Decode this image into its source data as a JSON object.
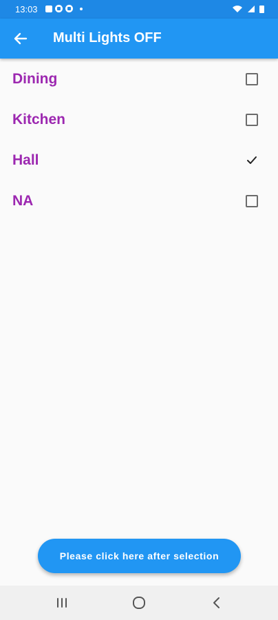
{
  "status_bar": {
    "time": "13:03",
    "left_icons": [
      "image-icon",
      "grid-app-icon",
      "grid-app-icon",
      "dot-icon"
    ],
    "right_icons": [
      "wifi-icon",
      "signal-icon",
      "battery-icon"
    ]
  },
  "app_bar": {
    "back_icon": "arrow-left-icon",
    "title": "Multi Lights OFF"
  },
  "lights": [
    {
      "label": "Dining",
      "checked": false
    },
    {
      "label": "Kitchen",
      "checked": false
    },
    {
      "label": "Hall",
      "checked": true
    },
    {
      "label": "NA",
      "checked": false
    }
  ],
  "action_button": {
    "label": "Please click here after selection"
  },
  "nav_bar": {
    "buttons": [
      "recent-apps-icon",
      "home-icon",
      "back-chevron-icon"
    ]
  },
  "colors": {
    "status_bar": "#1e88e5",
    "app_bar": "#2196f3",
    "item_label": "#9c27b0",
    "background": "#fafafa"
  }
}
